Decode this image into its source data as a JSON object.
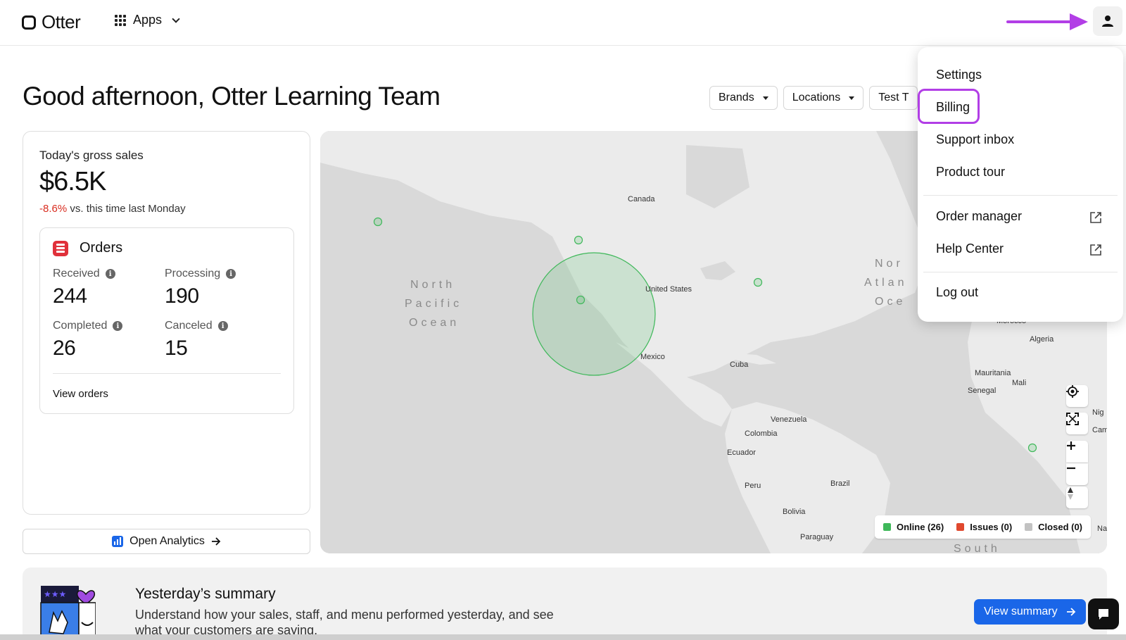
{
  "brand": {
    "name": "Otter"
  },
  "nav": {
    "apps_label": "Apps"
  },
  "greeting": "Good afternoon, Otter Learning Team",
  "filters": {
    "brands": "Brands",
    "locations": "Locations",
    "test_truncated": "Test T"
  },
  "sales": {
    "title": "Today's gross sales",
    "amount": "$6.5K",
    "delta": "-8.6%",
    "delta_suffix": " vs. this time last Monday"
  },
  "orders": {
    "title": "Orders",
    "received_label": "Received",
    "received_value": "244",
    "processing_label": "Processing",
    "processing_value": "190",
    "completed_label": "Completed",
    "completed_value": "26",
    "canceled_label": "Canceled",
    "canceled_value": "15",
    "view_link": "View orders"
  },
  "analytics": {
    "label": "Open Analytics"
  },
  "map": {
    "labels": {
      "canada": "Canada",
      "united_states": "United States",
      "mexico": "Mexico",
      "cuba": "Cuba",
      "venezuela": "Venezuela",
      "colombia": "Colombia",
      "ecuador": "Ecuador",
      "peru": "Peru",
      "brazil": "Brazil",
      "bolivia": "Bolivia",
      "paraguay": "Paraguay",
      "morocco": "Morocco",
      "algeria": "Algeria",
      "mauritania": "Mauritania",
      "mali": "Mali",
      "senegal": "Senegal",
      "niger_partial": "Nig",
      "cameroon_partial": "Camero",
      "na_partial": "Na",
      "south_partial": "South",
      "north_pacific_1": "North",
      "north_pacific_2": "Pacific",
      "north_pacific_3": "Ocean",
      "north_atlantic_1": "Nor",
      "north_atlantic_2": "Atlan",
      "north_atlantic_3": "Oce"
    },
    "legend": {
      "online": "Online (26)",
      "online_color": "#3fb85a",
      "issues": "Issues (0)",
      "issues_color": "#e0482e",
      "closed": "Closed (0)",
      "closed_color": "#c2c2c2"
    }
  },
  "summary": {
    "title": "Yesterday’s summary",
    "text": "Understand how your sales, staff, and menu performed yesterday, and see what your customers are saying.",
    "button": "View summary"
  },
  "user_menu": {
    "settings": "Settings",
    "billing": "Billing",
    "support_inbox": "Support inbox",
    "product_tour": "Product tour",
    "order_manager": "Order manager",
    "help_center": "Help Center",
    "log_out": "Log out"
  },
  "colors": {
    "accent": "#1a66e8",
    "annotation": "#b23ee6",
    "negative": "#d92d20"
  }
}
